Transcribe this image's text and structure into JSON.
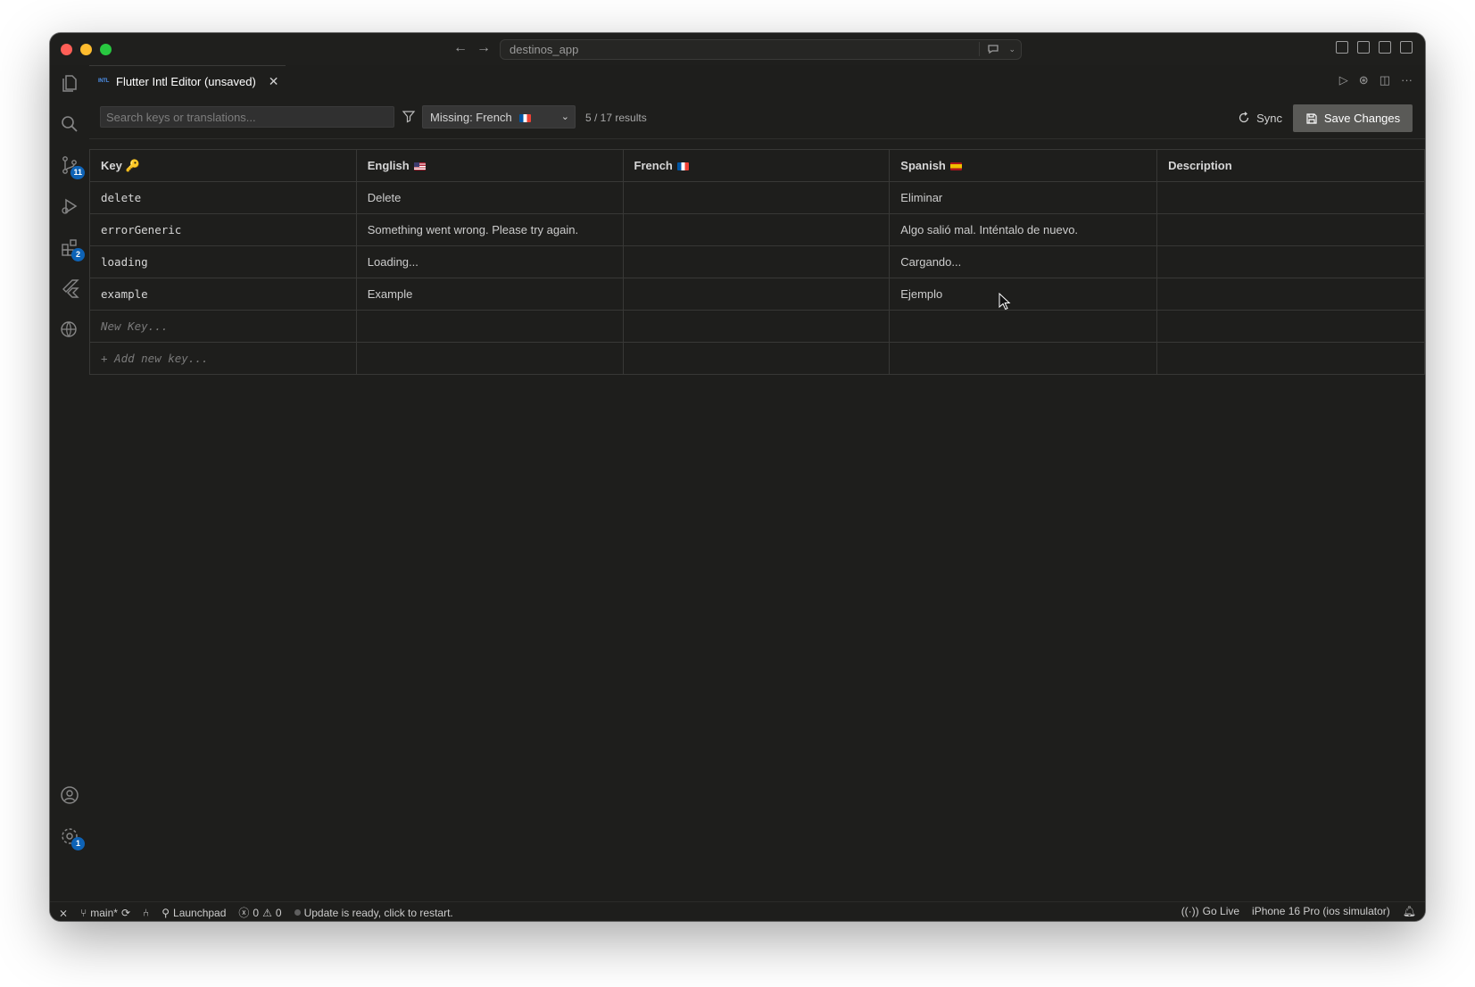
{
  "titlebar": {
    "command_center": "destinos_app"
  },
  "activity_bar": {
    "items": [
      {
        "name": "explorer",
        "badge": ""
      },
      {
        "name": "search",
        "badge": ""
      },
      {
        "name": "source-control",
        "badge": "11"
      },
      {
        "name": "run-debug",
        "badge": ""
      },
      {
        "name": "extensions",
        "badge": "2"
      },
      {
        "name": "flutter",
        "badge": ""
      },
      {
        "name": "remote-explorer",
        "badge": ""
      }
    ],
    "bottom": {
      "accounts_badge": "",
      "settings_badge": "1"
    }
  },
  "tab": {
    "icon_text": "INTL",
    "title": "Flutter Intl Editor (unsaved)"
  },
  "toolbar": {
    "search_placeholder": "Search keys or translations...",
    "filter_value": "Missing: French",
    "results": "5 / 17 results",
    "sync_label": "Sync",
    "save_label": "Save Changes"
  },
  "table": {
    "headers": [
      {
        "label": "Key",
        "emoji": "🔑",
        "flag": ""
      },
      {
        "label": "English",
        "flag": "us"
      },
      {
        "label": "French",
        "flag": "fr"
      },
      {
        "label": "Spanish",
        "flag": "es"
      },
      {
        "label": "Description",
        "flag": ""
      }
    ],
    "rows": [
      {
        "key": "delete",
        "en": "Delete",
        "fr": "",
        "es": "Eliminar",
        "desc": ""
      },
      {
        "key": "errorGeneric",
        "en": "Something went wrong. Please try again.",
        "fr": "",
        "es": "Algo salió mal. Inténtalo de nuevo.",
        "desc": ""
      },
      {
        "key": "loading",
        "en": "Loading...",
        "fr": "",
        "es": "Cargando...",
        "desc": ""
      },
      {
        "key": "example",
        "en": "Example",
        "fr": "",
        "es": "Ejemplo",
        "desc": ""
      }
    ],
    "new_key_placeholder": "New Key...",
    "add_key_label": "+ Add new key..."
  },
  "statusbar": {
    "branch": "main*",
    "launchpad": "Launchpad",
    "errors": "0",
    "warnings": "0",
    "update_message": "Update is ready, click to restart.",
    "go_live": "Go Live",
    "device": "iPhone 16 Pro (ios simulator)"
  }
}
